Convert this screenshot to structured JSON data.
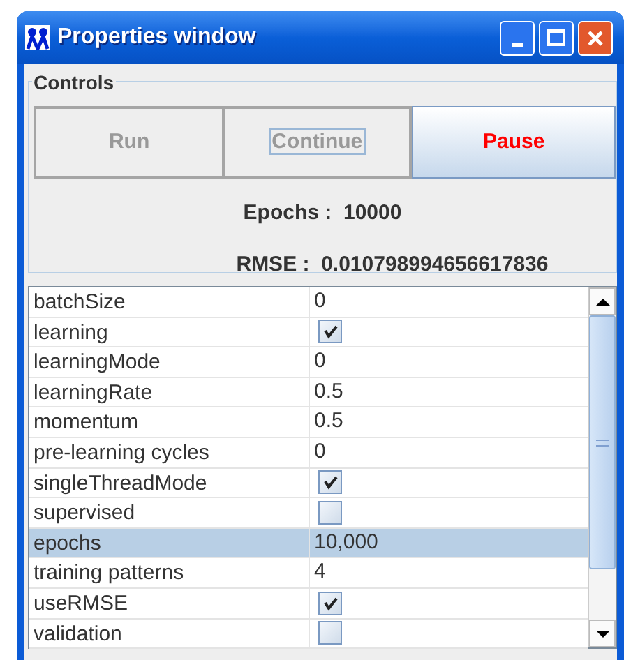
{
  "window": {
    "title": "Properties window"
  },
  "controls": {
    "title": "Controls",
    "buttons": [
      {
        "label": "Run",
        "disabled": true,
        "focused": false
      },
      {
        "label": "Continue",
        "disabled": true,
        "focused": true
      },
      {
        "label": "Pause",
        "disabled": false,
        "focused": false
      }
    ],
    "stats": [
      {
        "label": "Epochs :",
        "value": "10000"
      },
      {
        "label": "RMSE :",
        "value": "0.010798994656617836"
      }
    ]
  },
  "properties": [
    {
      "name": "batchSize",
      "kind": "text",
      "value": "0",
      "selected": false
    },
    {
      "name": "learning",
      "kind": "checkbox",
      "checked": true,
      "selected": false
    },
    {
      "name": "learningMode",
      "kind": "text",
      "value": "0",
      "selected": false
    },
    {
      "name": "learningRate",
      "kind": "text",
      "value": "0.5",
      "selected": false
    },
    {
      "name": "momentum",
      "kind": "text",
      "value": "0.5",
      "selected": false
    },
    {
      "name": "pre-learning cycles",
      "kind": "text",
      "value": "0",
      "selected": false
    },
    {
      "name": "singleThreadMode",
      "kind": "checkbox",
      "checked": true,
      "selected": false
    },
    {
      "name": "supervised",
      "kind": "checkbox",
      "checked": false,
      "selected": false
    },
    {
      "name": "epochs",
      "kind": "text",
      "value": "10,000",
      "selected": true
    },
    {
      "name": "training patterns",
      "kind": "text",
      "value": "4",
      "selected": false
    },
    {
      "name": "useRMSE",
      "kind": "checkbox",
      "checked": true,
      "selected": false
    },
    {
      "name": "validation",
      "kind": "checkbox",
      "checked": false,
      "selected": false
    }
  ]
}
